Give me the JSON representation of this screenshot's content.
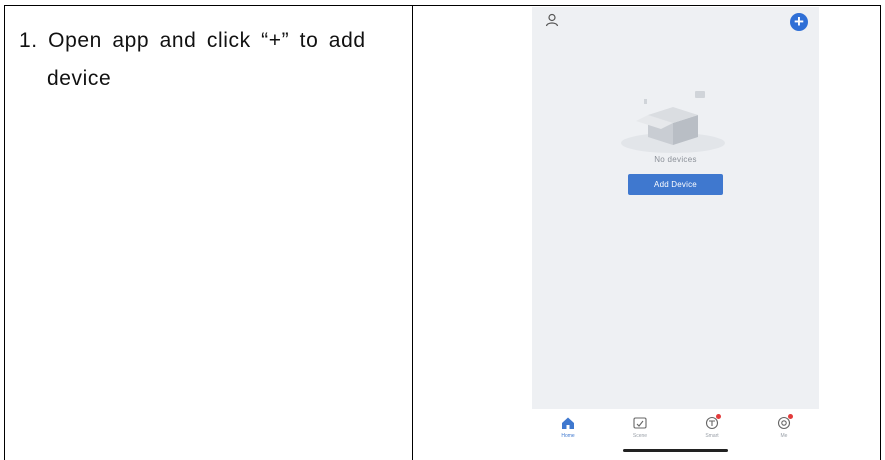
{
  "document": {
    "step_text_line1": "1. Open app and click “+” to add",
    "step_text_line2": "device"
  },
  "app": {
    "empty_state_text": "No devices",
    "add_device_button": "Add Device",
    "add_icon_glyph": "+",
    "icons": {
      "profile": "person-icon",
      "add": "plus-circle-icon"
    },
    "tabs": [
      {
        "label": "Home",
        "icon": "home-icon",
        "active": true
      },
      {
        "label": "Scene",
        "icon": "scene-icon",
        "active": false
      },
      {
        "label": "Smart",
        "icon": "smart-icon",
        "active": false,
        "badge": true
      },
      {
        "label": "Me",
        "icon": "me-icon",
        "active": false,
        "badge": true
      }
    ],
    "colors": {
      "accent": "#3f78cf",
      "background": "#eef0f3",
      "badge": "#e23b3b"
    }
  }
}
